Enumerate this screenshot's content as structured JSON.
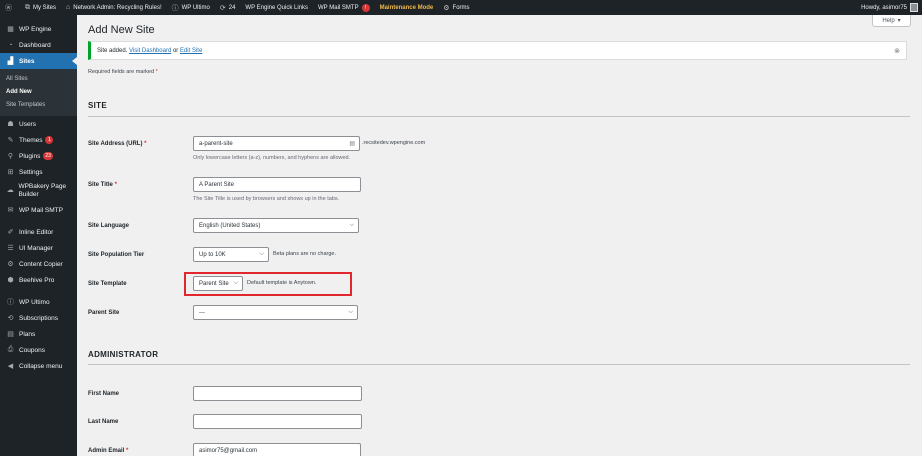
{
  "adminbar": {
    "items": [
      {
        "icon": "wordpress-icon",
        "glyph": "ⓦ",
        "label": ""
      },
      {
        "icon": "my-sites-icon",
        "glyph": "⧉",
        "label": "My Sites"
      },
      {
        "icon": "home-icon",
        "glyph": "⌂",
        "label": "Network Admin: Recycling Rules!"
      },
      {
        "icon": "wp-ultimo-icon",
        "glyph": "ⓘ",
        "label": "WP Ultimo"
      },
      {
        "icon": "updates-icon",
        "glyph": "⟳",
        "label": "24"
      },
      {
        "icon": "",
        "glyph": "",
        "label": "WP Engine Quick Links"
      },
      {
        "icon": "",
        "glyph": "",
        "label": "WP Mail SMTP",
        "badge": "!"
      },
      {
        "icon": "",
        "glyph": "",
        "label": "Maintenance Mode"
      },
      {
        "icon": "forms-icon",
        "glyph": "⚙",
        "label": "Forms"
      }
    ],
    "howdy": "Howdy, asimor75"
  },
  "sidebar": {
    "items": [
      {
        "name": "wp-engine",
        "icon": "wp-engine-icon",
        "glyph": "▦",
        "label": "WP Engine"
      },
      {
        "name": "dashboard",
        "icon": "dashboard-icon",
        "glyph": "◔",
        "label": "Dashboard"
      },
      {
        "name": "sites",
        "icon": "sites-icon",
        "glyph": "▟",
        "label": "Sites",
        "current": true
      },
      {
        "name": "users",
        "icon": "users-icon",
        "glyph": "☗",
        "label": "Users"
      },
      {
        "name": "themes",
        "icon": "themes-icon",
        "glyph": "✎",
        "label": "Themes",
        "badge": "1"
      },
      {
        "name": "plugins",
        "icon": "plugins-icon",
        "glyph": "⚲",
        "label": "Plugins",
        "badge": "23"
      },
      {
        "name": "settings",
        "icon": "settings-icon",
        "glyph": "⊞",
        "label": "Settings"
      },
      {
        "name": "wpbakery",
        "icon": "wpbakery-icon",
        "glyph": "☁",
        "label": "WPBakery Page Builder",
        "two_line": true
      },
      {
        "name": "wp-mail-smtp",
        "icon": "mail-icon",
        "glyph": "✉",
        "label": "WP Mail SMTP"
      },
      {
        "name": "inline-editor",
        "icon": "pencil-icon",
        "glyph": "✐",
        "label": "Inline Editor"
      },
      {
        "name": "ui-manager",
        "icon": "ui-manager-icon",
        "glyph": "☰",
        "label": "UI Manager"
      },
      {
        "name": "content-copier",
        "icon": "copier-icon",
        "glyph": "⚙",
        "label": "Content Copier"
      },
      {
        "name": "beehive-pro",
        "icon": "beehive-icon",
        "glyph": "⬢",
        "label": "Beehive Pro"
      },
      {
        "name": "wp-ultimo",
        "icon": "ultimo-icon",
        "glyph": "ⓘ",
        "label": "WP Ultimo"
      },
      {
        "name": "subscriptions",
        "icon": "subscriptions-icon",
        "glyph": "⟲",
        "label": "Subscriptions"
      },
      {
        "name": "plans",
        "icon": "plans-icon",
        "glyph": "▤",
        "label": "Plans"
      },
      {
        "name": "coupons",
        "icon": "coupons-icon",
        "glyph": "⎙",
        "label": "Coupons"
      },
      {
        "name": "collapse-menu",
        "icon": "collapse-icon",
        "glyph": "◀",
        "label": "Collapse menu"
      }
    ],
    "submenu": [
      {
        "label": "All Sites",
        "active": false
      },
      {
        "label": "Add New",
        "active": true
      },
      {
        "label": "Site Templates",
        "active": false
      }
    ]
  },
  "main": {
    "help_label": "Help",
    "page_title": "Add New Site",
    "notice": {
      "text": "Site added.",
      "link1": "Visit Dashboard",
      "middle": "or",
      "link2": "Edit Site"
    },
    "required_note": "Required fields are marked",
    "required_star": "*",
    "site_section": {
      "title": "SITE",
      "address_label": "Site Address (URL)",
      "address_value": "a-parent-site",
      "address_suffix": ".recsitedev.wpengine.com",
      "address_desc": "Only lowercase letters (a-z), numbers, and hyphens are allowed.",
      "title_label": "Site Title",
      "title_value": "A Parent Site",
      "title_desc": "The Site Title is used by browsers and shows up in the tabs.",
      "language_label": "Site Language",
      "language_value": "English (United States)",
      "tier_label": "Site Population Tier",
      "tier_value": "Up to 10K",
      "tier_note": "Beta plans are no charge.",
      "template_label": "Site Template",
      "template_value": "Parent Site",
      "template_note": "Default template is Anytown.",
      "parent_label": "Parent Site",
      "parent_value": "---"
    },
    "admin_section": {
      "title": "ADMINISTRATOR",
      "first_name_label": "First Name",
      "first_name_value": "",
      "last_name_label": "Last Name",
      "last_name_value": "",
      "email_label": "Admin Email",
      "email_value": "asimor75@gmail.com"
    }
  },
  "colors": {
    "accent": "#2271b1",
    "highlight": "#e0272b",
    "success": "#00a32a"
  }
}
